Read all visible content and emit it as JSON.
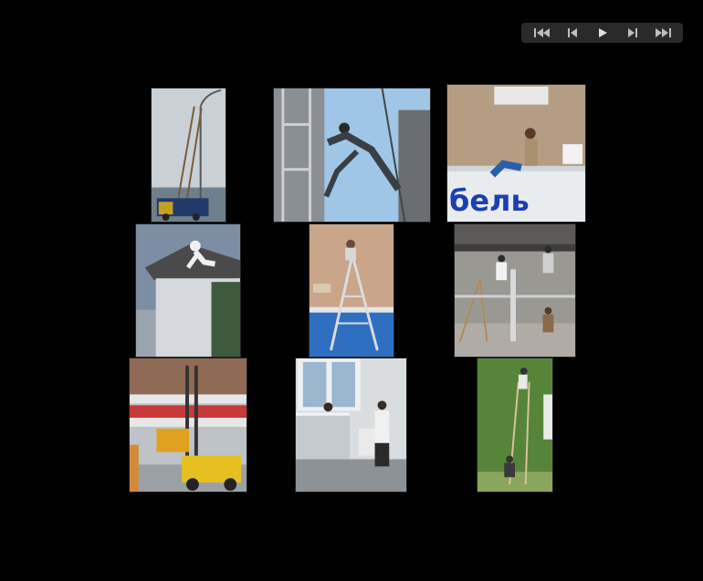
{
  "controls": {
    "buttons": [
      {
        "name": "first-button",
        "icon": "skip-first-icon"
      },
      {
        "name": "previous-button",
        "icon": "previous-icon"
      },
      {
        "name": "play-button",
        "icon": "play-icon"
      },
      {
        "name": "next-button",
        "icon": "next-icon"
      },
      {
        "name": "last-button",
        "icon": "skip-last-icon"
      }
    ],
    "icon_color": "#bdbdbd"
  },
  "gallery": {
    "photos": [
      {
        "subject": "ladder-on-truck-at-lamppost"
      },
      {
        "subject": "man-leaping-from-scaffold"
      },
      {
        "subject": "workers-on-storefront-sign",
        "sign_text": "бель"
      },
      {
        "subject": "man-on-roof-edge"
      },
      {
        "subject": "ladder-in-swimming-pool"
      },
      {
        "subject": "ladders-on-scaffold-under-roof"
      },
      {
        "subject": "forklift-lifting-forklift"
      },
      {
        "subject": "men-hanging-from-balcony"
      },
      {
        "subject": "ladder-against-hedge"
      }
    ]
  }
}
